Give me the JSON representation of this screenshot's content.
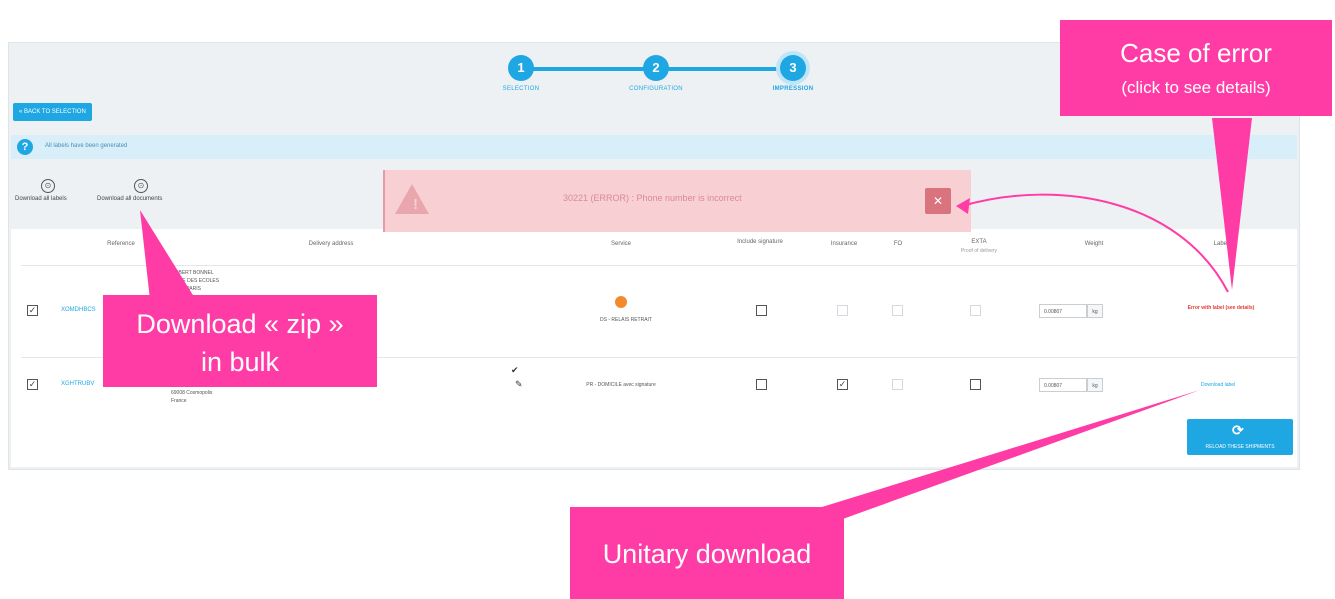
{
  "stepper": {
    "steps": [
      {
        "number": "1",
        "label": "SELECTION"
      },
      {
        "number": "2",
        "label": "CONFIGURATION"
      },
      {
        "number": "3",
        "label": "IMPRESSION"
      }
    ]
  },
  "toolbar": {
    "back_label": "« BACK TO SELECTION",
    "info_text": "All labels have been generated",
    "download_bulk_label": "Download all labels",
    "download_docs_label": "Download all documents"
  },
  "error_banner": {
    "message": "30221 (ERROR) : Phone number is incorrect",
    "close_glyph": "✕"
  },
  "table": {
    "headers": {
      "reference": "Reference",
      "address": "Delivery address",
      "service": "Service",
      "signature": "Include signature",
      "insurance": "Insurance",
      "fo": "FO",
      "extra": "EXTA",
      "extra_sub": "Proof of delivery",
      "weight": "Weight",
      "label": "Label"
    },
    "rows": [
      {
        "reference": "XOMDHBCS",
        "address_lines": [
          "ROBERT BONNEL",
          "4 RUE DES ECOLES",
          "75005 PARIS"
        ],
        "service": "DS - RELAIS RETRAIT",
        "weight": "0.00807",
        "unit": "kg",
        "status": "Error with label (see details)",
        "checked": true,
        "insurance": false,
        "extra": false
      },
      {
        "reference": "XGHTRUBV",
        "address_lines": [
          "69008 Cosmopolis",
          "France"
        ],
        "service": "PR - DOMICILE avec signature",
        "weight": "0.00807",
        "unit": "kg",
        "status": "Download label",
        "checked": true,
        "insurance": true,
        "extra": false
      }
    ],
    "reload_label": "RELOAD THESE SHIPMENTS"
  },
  "annotations": {
    "case_error_title": "Case of error",
    "case_error_sub": "(click to see details)",
    "bulk_line1": "Download « zip »",
    "bulk_line2": "in bulk",
    "unitary": "Unitary download"
  },
  "colors": {
    "accent": "#1ea7e3",
    "callout": "#ff3ca5",
    "error": "#e53935"
  }
}
